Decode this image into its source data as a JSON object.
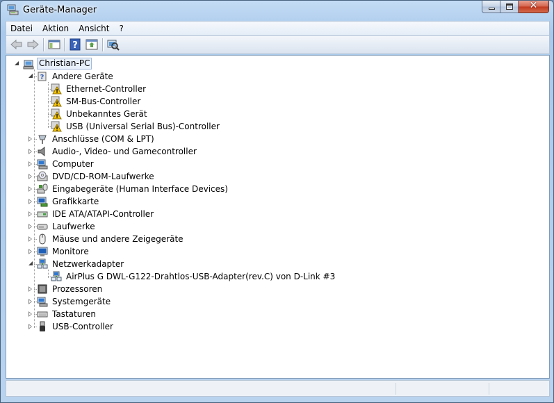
{
  "window": {
    "title": "Geräte-Manager"
  },
  "menu": [
    "Datei",
    "Aktion",
    "Ansicht",
    "?"
  ],
  "toolbar": [
    "back-icon",
    "forward-icon",
    "show-hide-console-tree-icon",
    "help-icon",
    "properties-icon",
    "scan-hardware-icon"
  ],
  "tree": {
    "root": "Christian-PC",
    "items": [
      {
        "label": "Andere Geräte",
        "icon": "unknown-device-icon",
        "expanded": true,
        "children": [
          {
            "label": "Ethernet-Controller",
            "icon": "warning-device-icon"
          },
          {
            "label": "SM-Bus-Controller",
            "icon": "warning-device-icon"
          },
          {
            "label": "Unbekanntes Gerät",
            "icon": "warning-device-icon"
          },
          {
            "label": "USB (Universal Serial Bus)-Controller",
            "icon": "warning-device-icon"
          }
        ]
      },
      {
        "label": "Anschlüsse (COM & LPT)",
        "icon": "port-icon"
      },
      {
        "label": "Audio-, Video- und Gamecontroller",
        "icon": "speaker-icon"
      },
      {
        "label": "Computer",
        "icon": "computer-icon"
      },
      {
        "label": "DVD/CD-ROM-Laufwerke",
        "icon": "dvd-drive-icon"
      },
      {
        "label": "Eingabegeräte (Human Interface Devices)",
        "icon": "hid-icon"
      },
      {
        "label": "Grafikkarte",
        "icon": "display-adapter-icon"
      },
      {
        "label": "IDE ATA/ATAPI-Controller",
        "icon": "ide-controller-icon"
      },
      {
        "label": "Laufwerke",
        "icon": "disk-drive-icon"
      },
      {
        "label": "Mäuse und andere Zeigegeräte",
        "icon": "mouse-icon"
      },
      {
        "label": "Monitore",
        "icon": "monitor-icon"
      },
      {
        "label": "Netzwerkadapter",
        "icon": "network-adapter-icon",
        "expanded": true,
        "children": [
          {
            "label": "AirPlus G DWL-G122-Drahtlos-USB-Adapter(rev.C) von D-Link #3",
            "icon": "network-adapter-icon"
          }
        ]
      },
      {
        "label": "Prozessoren",
        "icon": "processor-icon"
      },
      {
        "label": "Systemgeräte",
        "icon": "system-device-icon"
      },
      {
        "label": "Tastaturen",
        "icon": "keyboard-icon"
      },
      {
        "label": "USB-Controller",
        "icon": "usb-icon"
      }
    ]
  }
}
